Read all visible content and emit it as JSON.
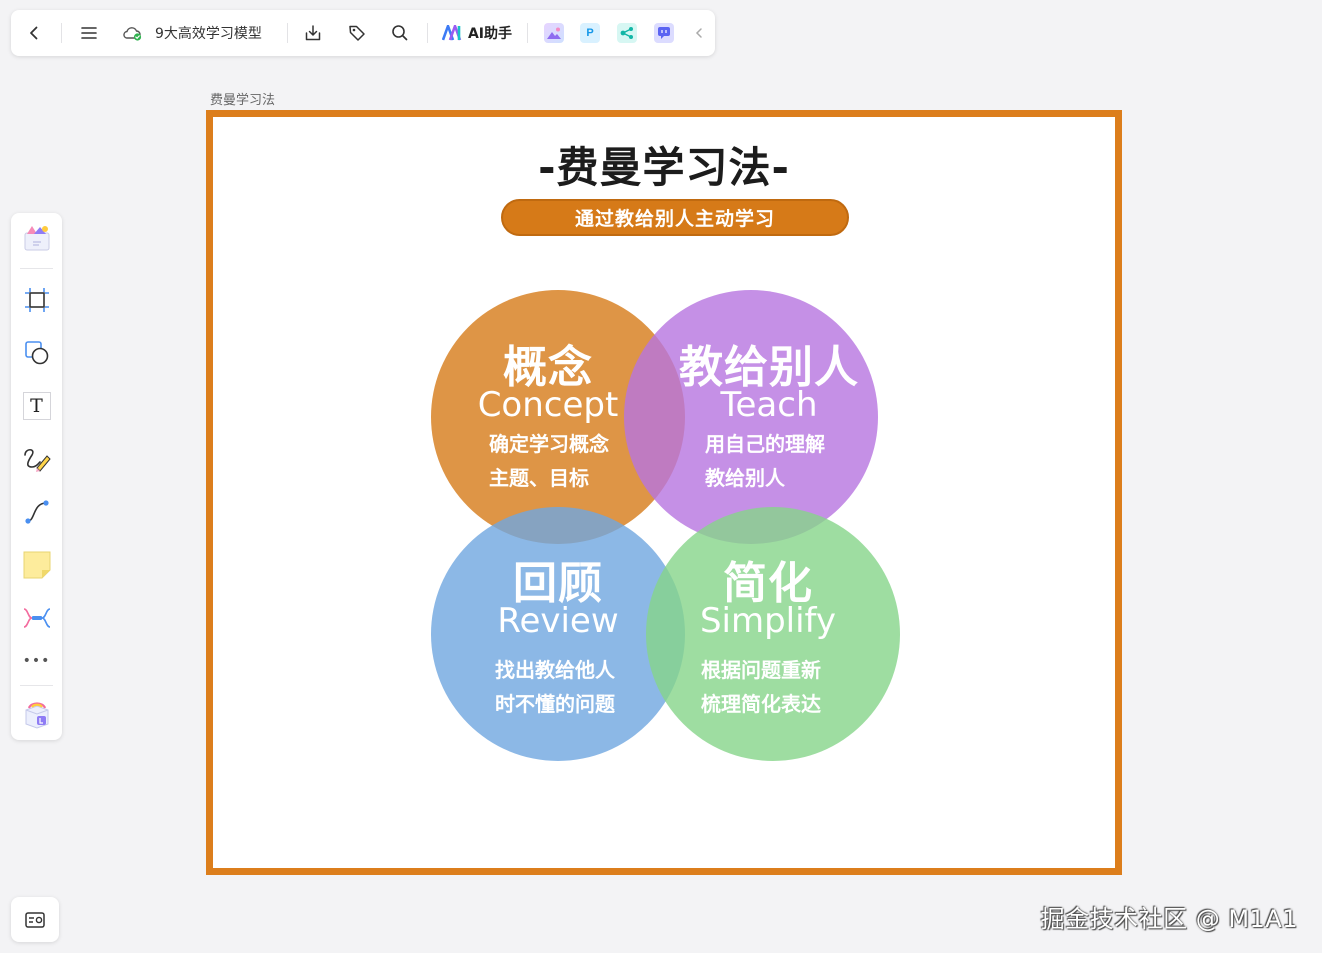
{
  "toolbar": {
    "back_icon": "chevron-left-icon",
    "menu_icon": "hamburger-icon",
    "doc_title": "9大高效学习模型",
    "sync_icon": "cloud-check-icon",
    "download_icon": "download-icon",
    "tag_icon": "tag-icon",
    "search_icon": "search-icon",
    "ai_label": "AI助手",
    "apps": [
      {
        "name": "image-app-icon"
      },
      {
        "name": "p-app-icon",
        "glyph": "P"
      },
      {
        "name": "mindmap-app-icon"
      },
      {
        "name": "chat-app-icon"
      }
    ],
    "collapse_icon": "chevron-left-small-icon"
  },
  "left_tools": [
    {
      "name": "template-icon"
    },
    {
      "name": "frame-icon"
    },
    {
      "name": "shape-icon"
    },
    {
      "name": "text-icon",
      "glyph": "T"
    },
    {
      "name": "pen-icon"
    },
    {
      "name": "connector-icon"
    },
    {
      "name": "sticky-note-icon"
    },
    {
      "name": "mindmap-icon"
    },
    {
      "name": "more-icon",
      "glyph": "•••"
    },
    {
      "name": "plugin-icon"
    }
  ],
  "bottom_tool": {
    "name": "map-navigator-icon"
  },
  "frame": {
    "label": "费曼学习法",
    "title": "-费曼学习法-",
    "subtitle": "通过教给别人主动学习",
    "colors": {
      "border": "#dc7e1c",
      "concept": "#d67a18",
      "teach": "#b774e0",
      "review": "#6fa6e0",
      "simplify": "#86d58a"
    },
    "circles": {
      "concept": {
        "cn": "概念",
        "en": "Concept",
        "desc1": "确定学习概念",
        "desc2": "主题、目标"
      },
      "teach": {
        "cn": "教给别人",
        "en": "Teach",
        "desc1": "用自己的理解",
        "desc2": "教给别人"
      },
      "review": {
        "cn": "回顾",
        "en": "Review",
        "desc1": "找出教给他人",
        "desc2": "时不懂的问题"
      },
      "simplify": {
        "cn": "简化",
        "en": "Simplify",
        "desc1": "根据问题重新",
        "desc2": "梳理简化表达"
      }
    }
  },
  "watermark": "掘金技术社区 @ M1A1"
}
